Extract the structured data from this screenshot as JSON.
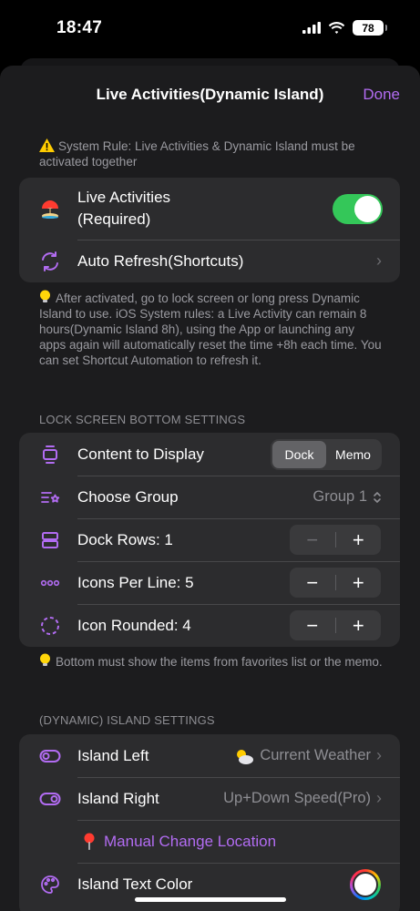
{
  "status": {
    "time": "18:47",
    "battery": "78"
  },
  "nav": {
    "title": "Live Activities(Dynamic Island)",
    "done": "Done"
  },
  "system_rule": "System Rule: Live Activities & Dynamic Island must be activated together",
  "live_group": {
    "live_activities_line1": "Live Activities",
    "live_activities_line2": "(Required)",
    "auto_refresh": "Auto Refresh(Shortcuts)"
  },
  "activation_note": "After activated, go to lock screen or long press Dynamic Island to use. iOS System rules: a Live Activity can remain 8 hours(Dynamic Island 8h), using the App or launching any apps again will automatically reset the time +8h each time. You can set Shortcut Automation to refresh it.",
  "lock_screen": {
    "header": "LOCK SCREEN BOTTOM SETTINGS",
    "content_label": "Content to Display",
    "seg_dock": "Dock",
    "seg_memo": "Memo",
    "group_label": "Choose Group",
    "group_value": "Group 1",
    "dock_rows": "Dock Rows: 1",
    "icons_per_line": "Icons Per Line: 5",
    "icon_rounded": "Icon Rounded: 4",
    "minus": "−",
    "plus": "+"
  },
  "bottom_note": "Bottom must show the items from favorites list or the memo.",
  "island": {
    "header": "(DYNAMIC) ISLAND SETTINGS",
    "left_label": "Island Left",
    "left_value": "Current Weather",
    "right_label": "Island Right",
    "right_value": "Up+Down Speed(Pro)",
    "manual_location": "Manual Change Location",
    "text_color": "Island Text Color"
  },
  "colors": {
    "accent": "#b26cf2",
    "toggle_on": "#34c759",
    "background": "#1c1c1e",
    "cell": "#2c2c2e"
  }
}
